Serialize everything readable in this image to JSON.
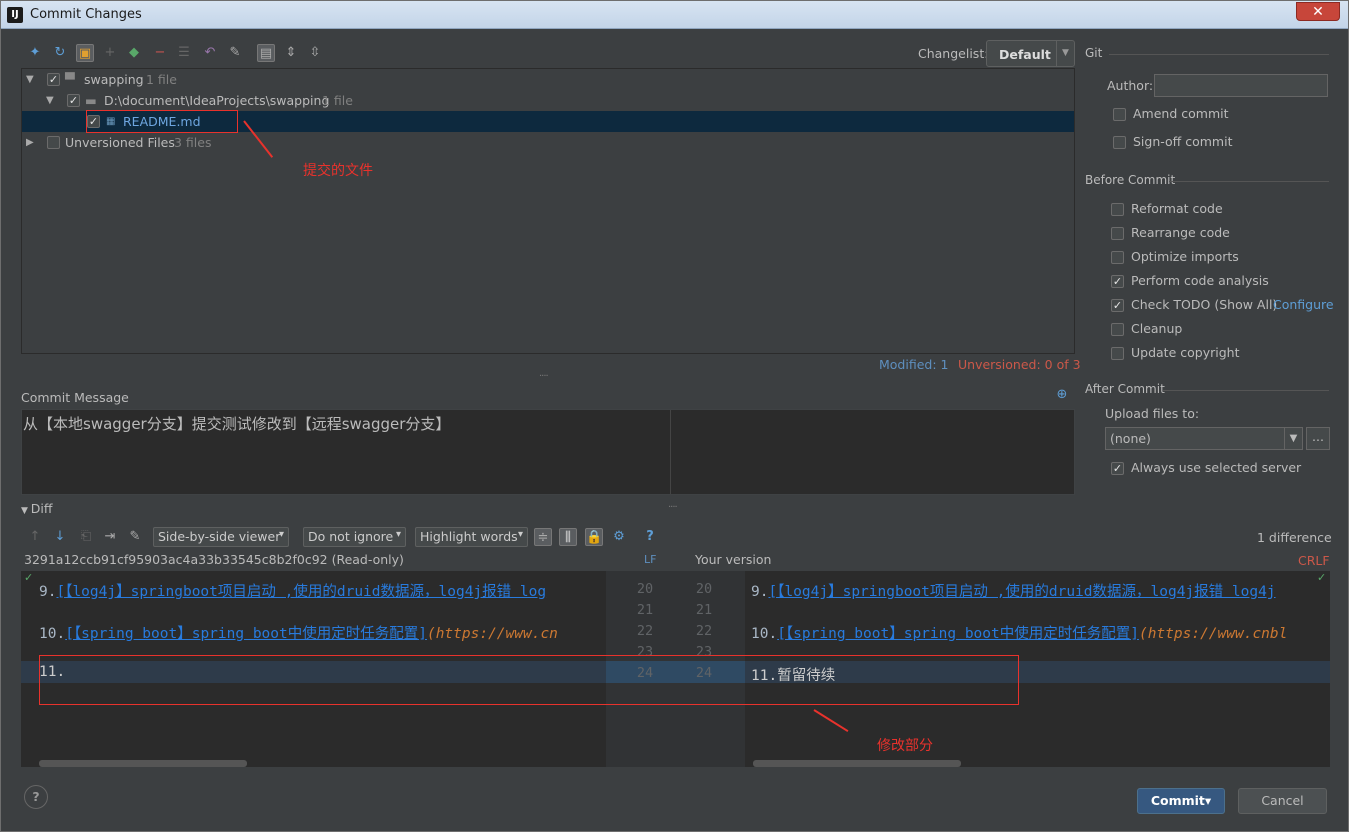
{
  "window": {
    "title": "Commit Changes",
    "app_icon": "IJ",
    "close_symbol": "✕"
  },
  "toolbar": {
    "icons": [
      "diff-icon",
      "refresh-icon",
      "move-to-changelist-icon",
      "plus-icon",
      "group-icon",
      "minus-icon",
      "expand-icon",
      "rollback-icon",
      "edit-source-icon",
      "flatten-icon",
      "expand-all-icon",
      "collapse-all-icon"
    ],
    "changelist_label": "Changelist:",
    "changelist_value": "Default"
  },
  "tree": {
    "root": {
      "name": "swapping",
      "count": "1 file"
    },
    "folder": {
      "name": "D:\\document\\IdeaProjects\\swapping",
      "count": "1 file"
    },
    "file": {
      "name": "README.md",
      "icon": "markdown-file-icon"
    },
    "unversioned": {
      "name": "Unversioned Files",
      "count": "3 files"
    }
  },
  "annotations": {
    "files": "提交的文件",
    "changes": "修改部分"
  },
  "status": {
    "modified": "Modified: 1",
    "unversioned": "Unversioned: 0 of 3"
  },
  "commit_message": {
    "label": "Commit Message",
    "text": "从【本地swagger分支】提交测试修改到【远程swagger分支】"
  },
  "diff": {
    "label": "Diff",
    "viewer": "Side-by-side viewer",
    "ignore": "Do not ignore",
    "highlight": "Highlight words",
    "count": "1 difference",
    "left_title": "3291a12ccb91cf95903ac4a33b33545c8b2f0c92 (Read-only)",
    "lf": "LF",
    "right_title": "Your version",
    "crlf": "CRLF",
    "left_numbers": [
      "20",
      "21",
      "22",
      "23",
      "24"
    ],
    "right_numbers": [
      "20",
      "21",
      "22",
      "23",
      "24"
    ],
    "left_lines": [
      {
        "num": "9.",
        "link": "[【log4j】springboot项目启动 ,使用的druid数据源，log4j报错 log"
      },
      {
        "num": "10.",
        "link": "[【spring boot】spring boot中使用定时任务配置]",
        "url": "(https://www.cn"
      },
      {
        "num": "11.",
        "link": "",
        "text": ""
      }
    ],
    "right_lines": [
      {
        "num": "9.",
        "link": "[【log4j】springboot项目启动 ,使用的druid数据源，log4j报错 log4j"
      },
      {
        "num": "10.",
        "link": "[【spring boot】spring boot中使用定时任务配置]",
        "url": "(https://www.cnbl"
      },
      {
        "num": "11.",
        "text": "暂留待续"
      }
    ]
  },
  "right_panel": {
    "git": "Git",
    "author_label": "Author:",
    "author_value": "",
    "amend": "Amend commit",
    "signoff": "Sign-off commit",
    "before_commit": "Before Commit",
    "options": [
      {
        "label": "Reformat code",
        "checked": false
      },
      {
        "label": "Rearrange code",
        "checked": false
      },
      {
        "label": "Optimize imports",
        "checked": false
      },
      {
        "label": "Perform code analysis",
        "checked": true
      },
      {
        "label": "Check TODO (Show All)",
        "checked": true
      },
      {
        "label": "Cleanup",
        "checked": false
      },
      {
        "label": "Update copyright",
        "checked": false
      }
    ],
    "configure": "Configure",
    "after_commit": "After Commit",
    "upload_label": "Upload files to:",
    "upload_value": "(none)",
    "more": "...",
    "always_use": "Always use selected server"
  },
  "buttons": {
    "help": "?",
    "commit": "Commit▾",
    "cancel": "Cancel"
  }
}
